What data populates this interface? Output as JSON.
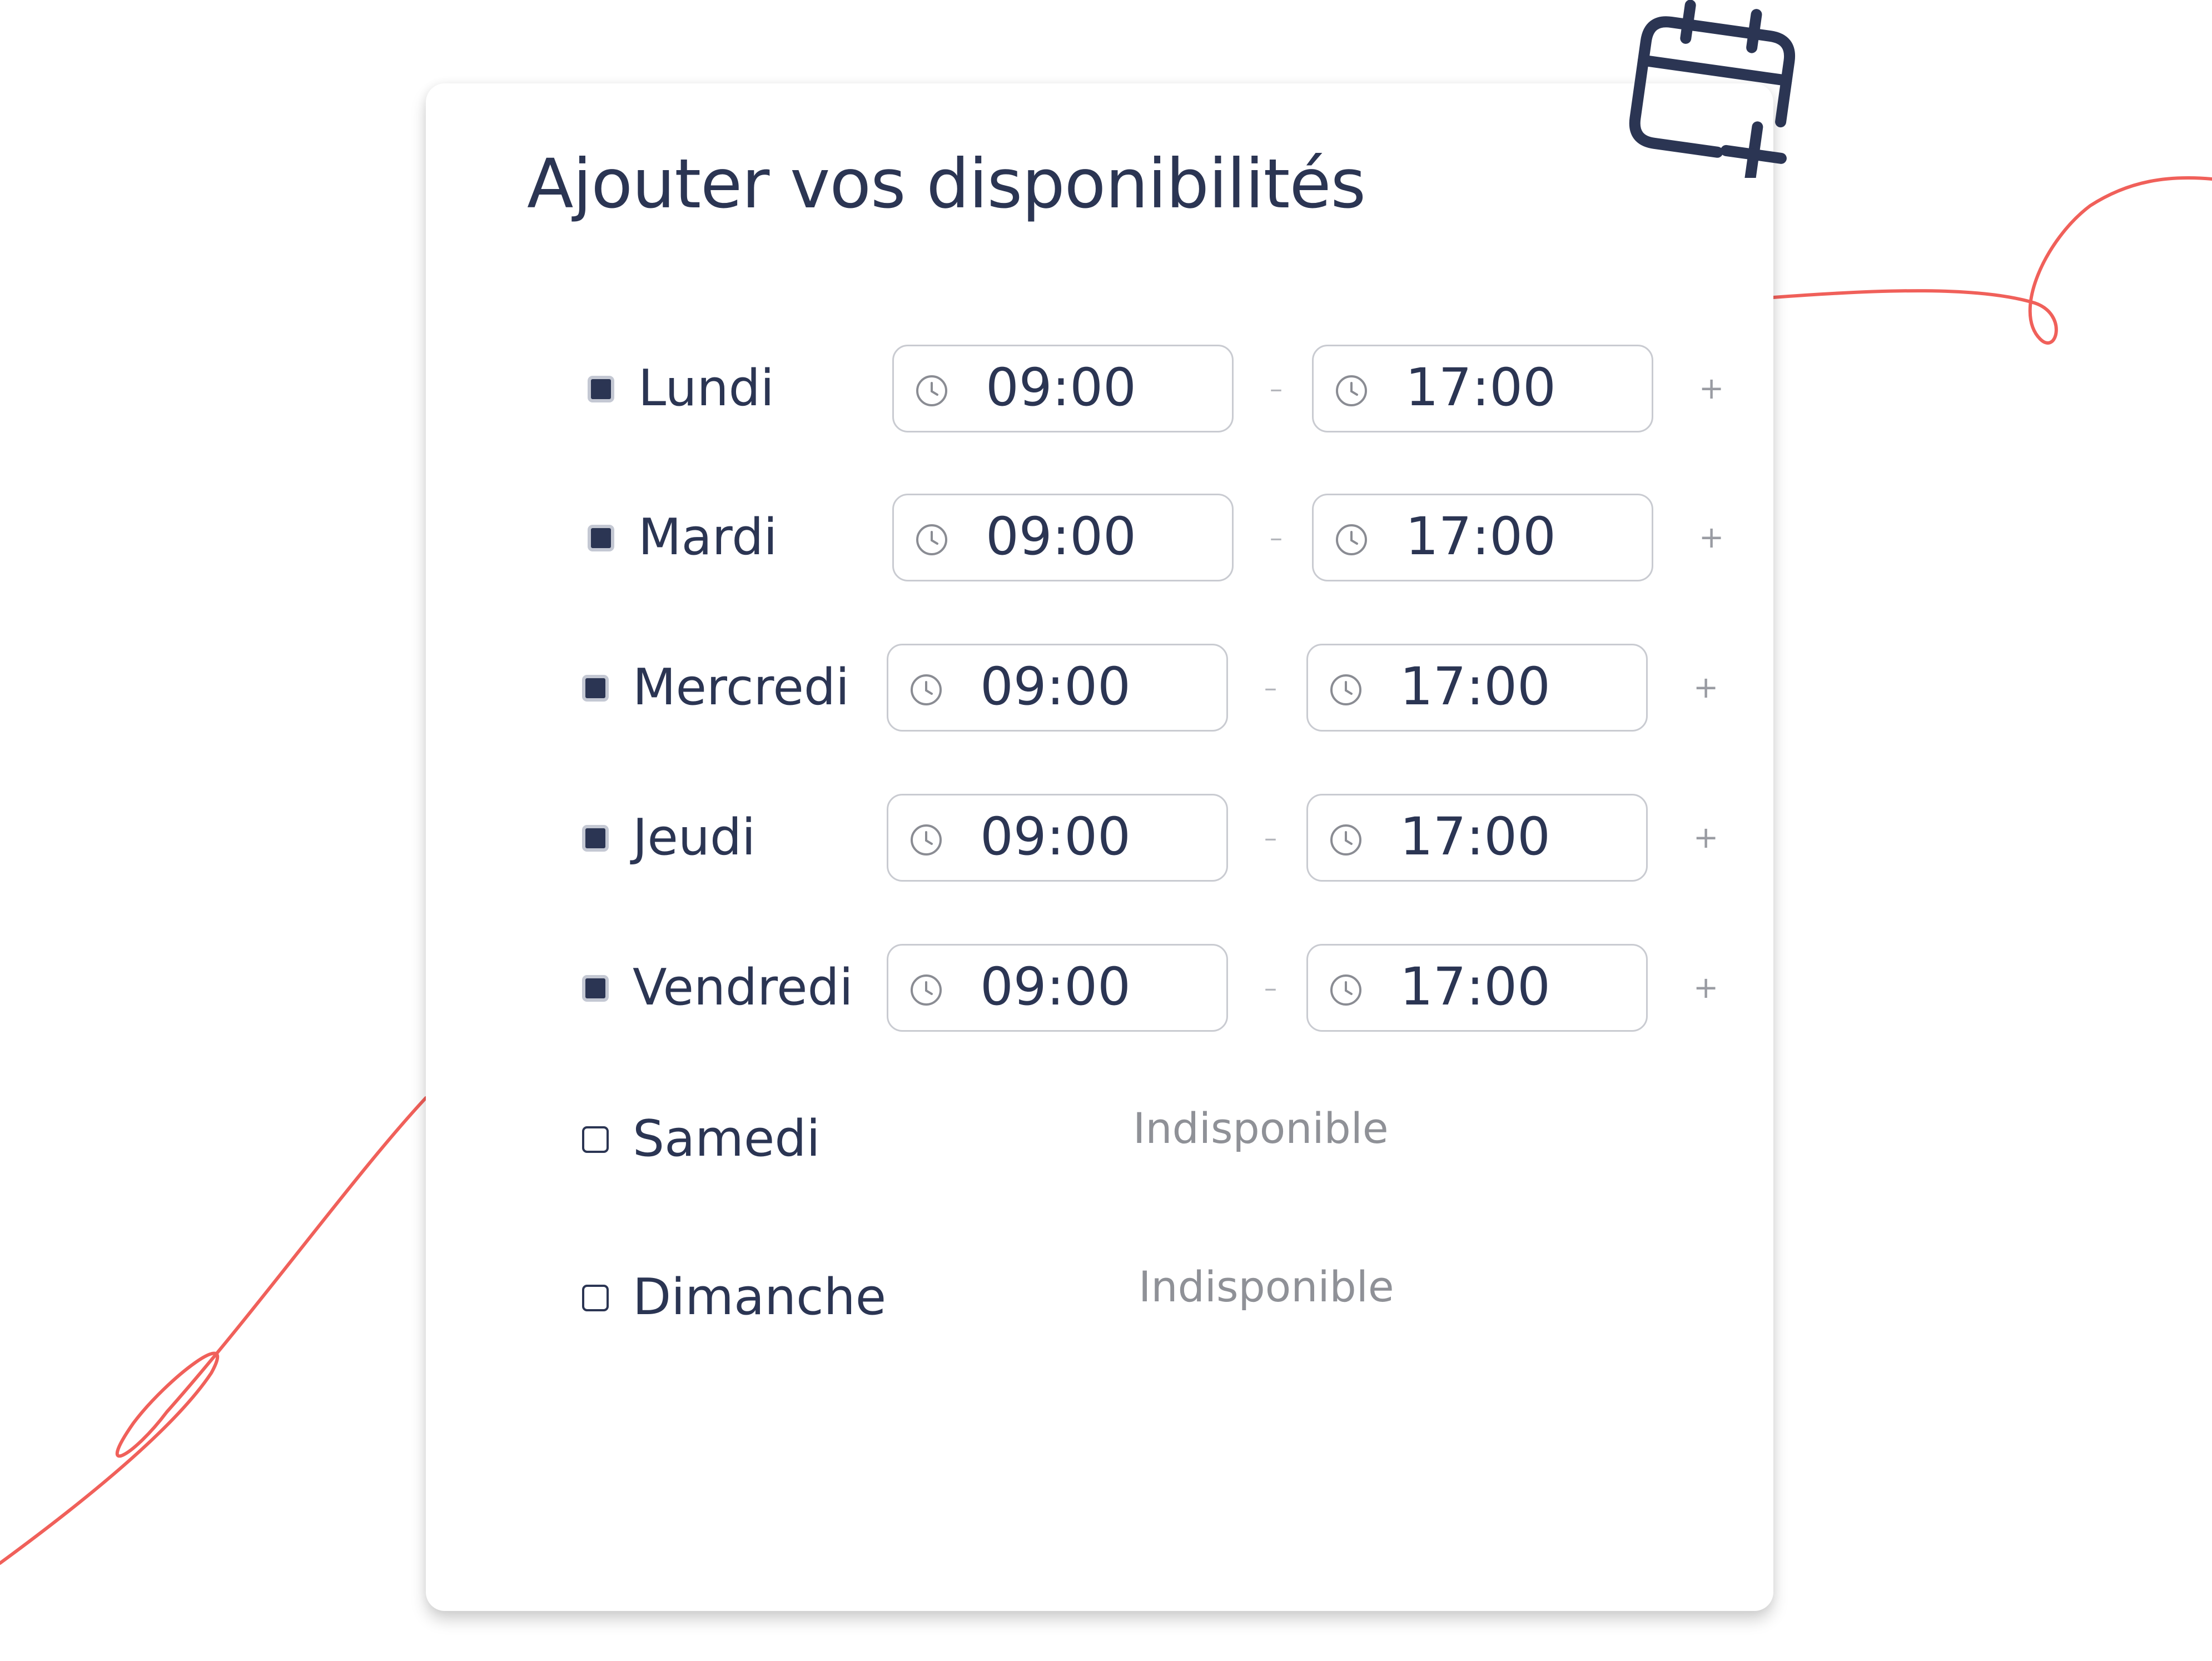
{
  "panel": {
    "title": "Ajouter vos disponibilités"
  },
  "icons": {
    "header": "calendar-plus-icon",
    "time_field": "clock-icon"
  },
  "colors": {
    "text": "#2b3553",
    "muted": "#8f9197",
    "field_border": "#c9cbd1",
    "decoration": "#f0605a"
  },
  "separator": "–",
  "add_symbol": "+",
  "days": [
    {
      "name": "Lundi",
      "checked": true,
      "start": "09:00",
      "end": "17:00",
      "status": ""
    },
    {
      "name": "Mardi",
      "checked": true,
      "start": "09:00",
      "end": "17:00",
      "status": ""
    },
    {
      "name": "Mercredi",
      "checked": true,
      "start": "09:00",
      "end": "17:00",
      "status": ""
    },
    {
      "name": "Jeudi",
      "checked": true,
      "start": "09:00",
      "end": "17:00",
      "status": ""
    },
    {
      "name": "Vendredi",
      "checked": true,
      "start": "09:00",
      "end": "17:00",
      "status": ""
    },
    {
      "name": "Samedi",
      "checked": false,
      "start": "",
      "end": "",
      "status": "Indisponible"
    },
    {
      "name": "Dimanche",
      "checked": false,
      "start": "",
      "end": "",
      "status": "Indisponible"
    }
  ]
}
